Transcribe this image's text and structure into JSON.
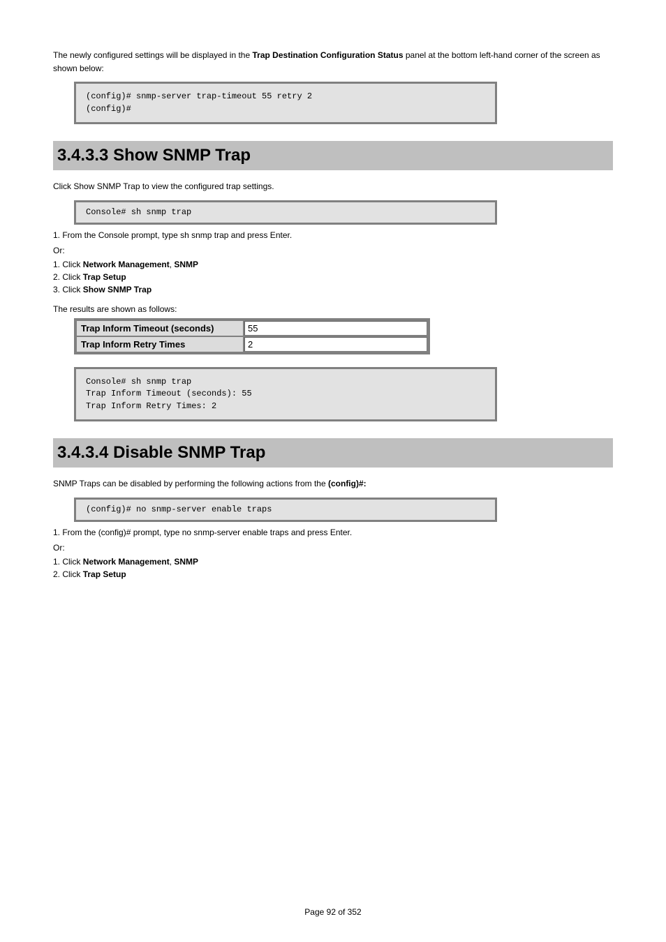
{
  "para1_pre": "The newly configured settings will be displayed in the ",
  "para1_strong": "Trap Destination Configuration Status",
  "para1_post": " panel at the bottom left-hand corner of the screen as shown below:",
  "code1": "(config)# snmp-server trap-timeout 55 retry 2\n(config)#",
  "section1_title": "3.4.3.3 Show SNMP Trap",
  "section1_intro_pre": "Click ",
  "section1_intro_link": "Show SNMP Trap",
  "section1_intro_post": " to view the configured trap settings.",
  "code2": "Console# sh snmp trap",
  "step1": "1. From the Console prompt, type sh snmp trap and press Enter.",
  "step2_intro": "Or:",
  "step2a_pre": "1. Click ",
  "step2a_strong": "Network Management",
  "step2a_mid": ", ",
  "step2a_strong2": "SNMP",
  "step2b_pre": "2. Click ",
  "step2b_strong": "Trap Setup",
  "step2c_pre": "3. Click ",
  "step2c_strong": "Show SNMP Trap",
  "result_intro": "The results are shown as follows:",
  "table": {
    "row1_label": "Trap Inform Timeout (seconds)",
    "row1_value": "55",
    "row2_label": "Trap Inform Retry Times",
    "row2_value": "2"
  },
  "code3": "Console# sh snmp trap\nTrap Inform Timeout (seconds): 55\nTrap Inform Retry Times: 2",
  "section2_title": "3.4.3.4 Disable SNMP Trap",
  "section2_intro_pre": "SNMP Traps can be disabled by performing the following actions from the ",
  "section2_intro_strong": "(config)#:",
  "code4": "(config)# no snmp-server enable traps",
  "stepB1": "1. From the (config)# prompt, type no snmp-server enable traps and press Enter.",
  "stepB_or": "Or:",
  "stepBa_pre": "1. Click ",
  "stepBa_strong1": "Network Management",
  "stepBa_mid": ", ",
  "stepBa_strong2": "SNMP",
  "stepBb_pre": "2. Click ",
  "stepBb_strong": "Trap Setup",
  "footer": "Page 92 of 352"
}
